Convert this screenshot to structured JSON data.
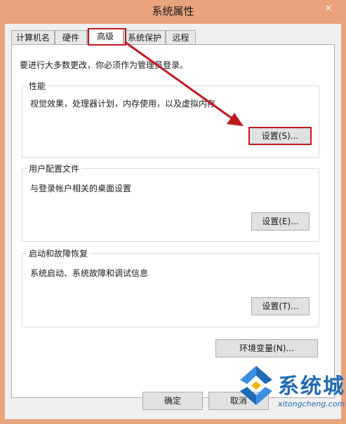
{
  "window": {
    "title": "系统属性",
    "close_glyph": "✕"
  },
  "tabs": [
    {
      "label": "计算机名"
    },
    {
      "label": "硬件"
    },
    {
      "label": "高级"
    },
    {
      "label": "系统保护"
    },
    {
      "label": "远程"
    }
  ],
  "notice": "要进行大多数更改，你必须作为管理员登录。",
  "performance": {
    "title": "性能",
    "desc": "视觉效果，处理器计划，内存使用，以及虚拟内存",
    "button": "设置(S)..."
  },
  "profiles": {
    "title": "用户配置文件",
    "desc": "与登录帐户相关的桌面设置",
    "button": "设置(E)..."
  },
  "startup": {
    "title": "启动和故障恢复",
    "desc": "系统启动、系统故障和调试信息",
    "button": "设置(T)..."
  },
  "env_button": "环境变量(N)...",
  "footer": {
    "ok": "确定",
    "cancel": "取消"
  },
  "watermark": {
    "brand": "系统城",
    "site": "xitongcheng.com"
  },
  "colors": {
    "titlebar": "#e9a37d",
    "highlight": "#c0181f",
    "brand": "#1f6bb5"
  }
}
